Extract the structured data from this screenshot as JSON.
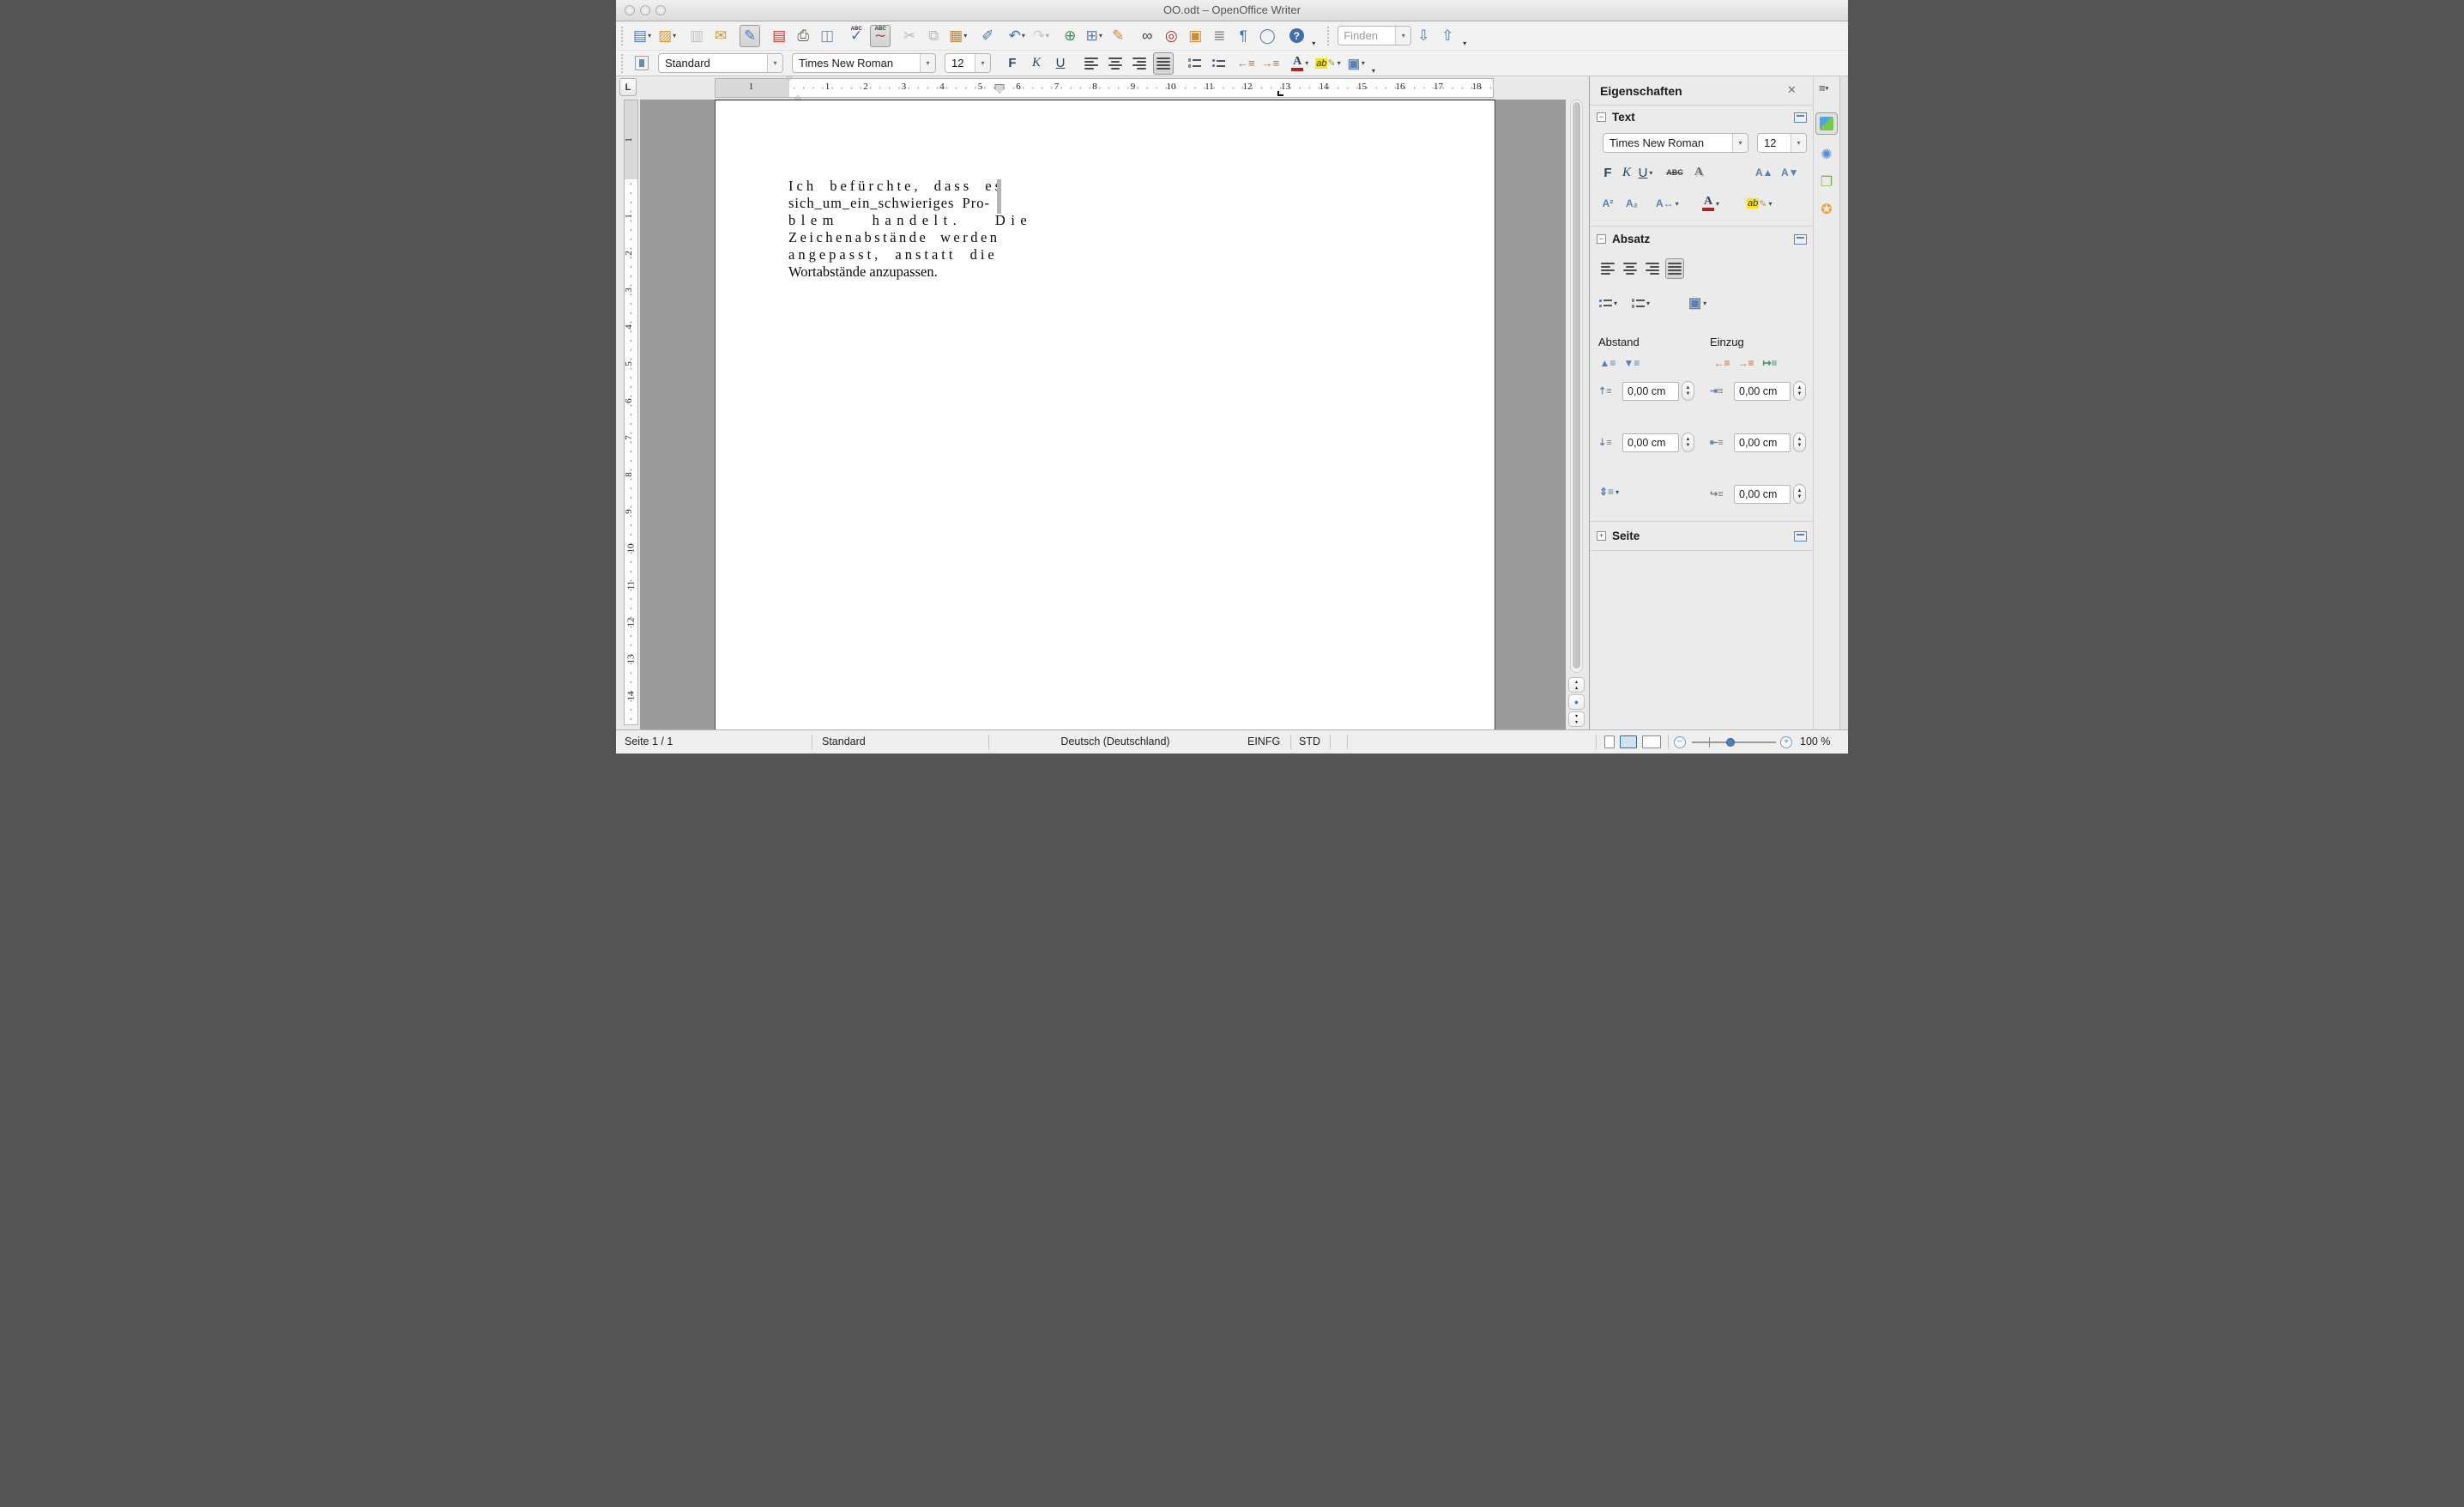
{
  "window": {
    "title": "OO.odt – OpenOffice Writer"
  },
  "icons": {
    "close": "✕",
    "panel-menu": "≡",
    "menu-arrow": "▾",
    "dropdown": "▾",
    "overflow": "▾",
    "collapse": "−",
    "expand": "+",
    "tab-stop-left": "L",
    "find-down": "⇩",
    "find-up": "⇧",
    "spin-up": "▲",
    "spin-down": "▼",
    "grow-font": "A▲",
    "shrink-font": "A▼",
    "superscript": "A²",
    "subscript": "A₂",
    "char-spacing": "A↔",
    "para-background": "▣",
    "para-spacing-increase": "▲≡",
    "para-spacing-decrease": "▼≡",
    "indent-decrease": "←≡",
    "indent-increase": "→≡",
    "hanging-indent": "↦≡",
    "line-spacing": "⇕≡",
    "spacing-above": "⇡≡",
    "spacing-below": "⇣≡",
    "indent-before": "⇥≡",
    "indent-after": "⇤≡",
    "first-line-indent": "↪≡",
    "prev-page": "▴\n▴",
    "next-page": "▾\n▾",
    "navigation-dot": "●",
    "styles-tab": "✺",
    "gallery-tab": "❐",
    "navigator-tab": "✪"
  },
  "toolbar_standard": {
    "items": [
      {
        "name": "new-document-button",
        "glyph": "▤",
        "color": "#4a7ab5",
        "dropdown": true
      },
      {
        "name": "open-button",
        "glyph": "▨",
        "color": "#e0952f",
        "dropdown": true
      },
      {
        "name": "save-button",
        "glyph": "▥",
        "color": "#8a8a8a",
        "disabled": true,
        "gap": true
      },
      {
        "name": "email-button",
        "glyph": "✉",
        "color": "#c79a3b"
      },
      {
        "name": "edit-mode-button",
        "glyph": "✎",
        "color": "#4a7ab5",
        "pressed": true,
        "gap": true
      },
      {
        "name": "export-pdf-button",
        "glyph": "▤",
        "color": "#c0392b",
        "gap": true
      },
      {
        "name": "print-button",
        "glyph": "⎙",
        "color": "#5d5d5d"
      },
      {
        "name": "print-preview-button",
        "glyph": "◫",
        "color": "#7a8aa0"
      },
      {
        "name": "spellcheck-button",
        "glyph": "✓",
        "color": "#3f6fae",
        "label": "ABC",
        "gap": true
      },
      {
        "name": "autospellcheck-button",
        "glyph": "∼",
        "color": "#c0392b",
        "label": "ABC",
        "pressed": true
      },
      {
        "name": "cut-button",
        "glyph": "✂",
        "color": "#777",
        "disabled": true,
        "gap": true
      },
      {
        "name": "copy-button",
        "glyph": "⧉",
        "color": "#777",
        "disabled": true
      },
      {
        "name": "paste-button",
        "glyph": "▦",
        "color": "#b5884a",
        "dropdown": true
      },
      {
        "name": "format-paintbrush-button",
        "glyph": "✐",
        "color": "#4a7ab5",
        "gap": true
      },
      {
        "name": "undo-button",
        "glyph": "↶",
        "color": "#3f6fae",
        "dropdown": true,
        "gap": true
      },
      {
        "name": "redo-button",
        "glyph": "↷",
        "color": "#9a9a9a",
        "disabled": true,
        "dropdown": true
      },
      {
        "name": "hyperlink-button",
        "glyph": "⊕",
        "color": "#3e8e5a",
        "gap": true
      },
      {
        "name": "table-button",
        "glyph": "⊞",
        "color": "#5b7fae",
        "dropdown": true
      },
      {
        "name": "draw-functions-button",
        "glyph": "✎",
        "color": "#d2833a"
      },
      {
        "name": "find-replace-button",
        "glyph": "∞",
        "color": "#3d3d3d",
        "gap": true
      },
      {
        "name": "navigator-button",
        "glyph": "◎",
        "color": "#b03030"
      },
      {
        "name": "gallery-button",
        "glyph": "▣",
        "color": "#cf8c2a"
      },
      {
        "name": "data-sources-button",
        "glyph": "≣",
        "color": "#8a8a8a"
      },
      {
        "name": "formatting-marks-button",
        "glyph": "¶",
        "color": "#3f6fae"
      },
      {
        "name": "zoom-button",
        "glyph": "◯",
        "color": "#5b7fae"
      },
      {
        "name": "help-button",
        "glyph": "?",
        "color": "#ffffff",
        "round": true,
        "gap": true
      }
    ],
    "find": {
      "placeholder": "Finden"
    }
  },
  "toolbar_formatting": {
    "paragraph_style_value": "Standard",
    "font_name_value": "Times New Roman",
    "font_size_value": "12",
    "bold_label": "F",
    "italic_label": "K",
    "underline_label": "U",
    "font_color_label": "A",
    "font_color_bar": "#b22222",
    "highlight_label": "ab",
    "highlight_color": "#f7e617"
  },
  "ruler_h": {
    "margin_number": "1",
    "numbers": [
      "1",
      "2",
      "3",
      "4",
      "5",
      "6",
      "7",
      "8",
      "9",
      "10",
      "11",
      "12",
      "13",
      "14",
      "15",
      "16",
      "17",
      "18"
    ]
  },
  "ruler_v": {
    "margin_number": "1",
    "numbers": [
      "1",
      "2",
      "3",
      "4",
      "5",
      "6",
      "7",
      "8",
      "9",
      "10",
      "11",
      "12",
      "13",
      "14"
    ]
  },
  "document": {
    "lines": [
      {
        "text": "Ich befürchte, dass es",
        "ls": 4,
        "ws": 7
      },
      {
        "text": "sich_um_ein_schwieriges Pro-",
        "ls": 1,
        "ws": 4
      },
      {
        "text": "blem handelt. Die",
        "ls": 6.5,
        "ws": 28
      },
      {
        "text": "Zeichenabstände werden",
        "ls": 3.5,
        "ws": 6
      },
      {
        "text": "angepasst, anstatt die",
        "ls": 4,
        "ws": 8
      },
      {
        "text": "Wortabstände anzupassen.",
        "ls": 0,
        "ws": 0
      }
    ]
  },
  "sidebar": {
    "title": "Eigenschaften",
    "text_section_label": "Text",
    "paragraph_section_label": "Absatz",
    "page_section_label": "Seite",
    "text_panel": {
      "font_name": "Times New Roman",
      "font_size": "12",
      "bold": "F",
      "italic": "K",
      "underline": "U",
      "strikethrough": "ABC",
      "shadow": "A",
      "font_color": "A",
      "highlight": "ab"
    },
    "paragraph_panel": {
      "spacing_label": "Abstand",
      "indent_label": "Einzug",
      "fields": {
        "above": "0,00 cm",
        "below": "0,00 cm",
        "before": "0,00 cm",
        "after": "0,00 cm",
        "firstline": "0,00 cm"
      }
    }
  },
  "status_bar": {
    "page": "Seite 1 / 1",
    "style": "Standard",
    "language": "Deutsch (Deutschland)",
    "insert_mode": "EINFG",
    "selection_mode": "STD",
    "zoom_value": "100 %"
  }
}
